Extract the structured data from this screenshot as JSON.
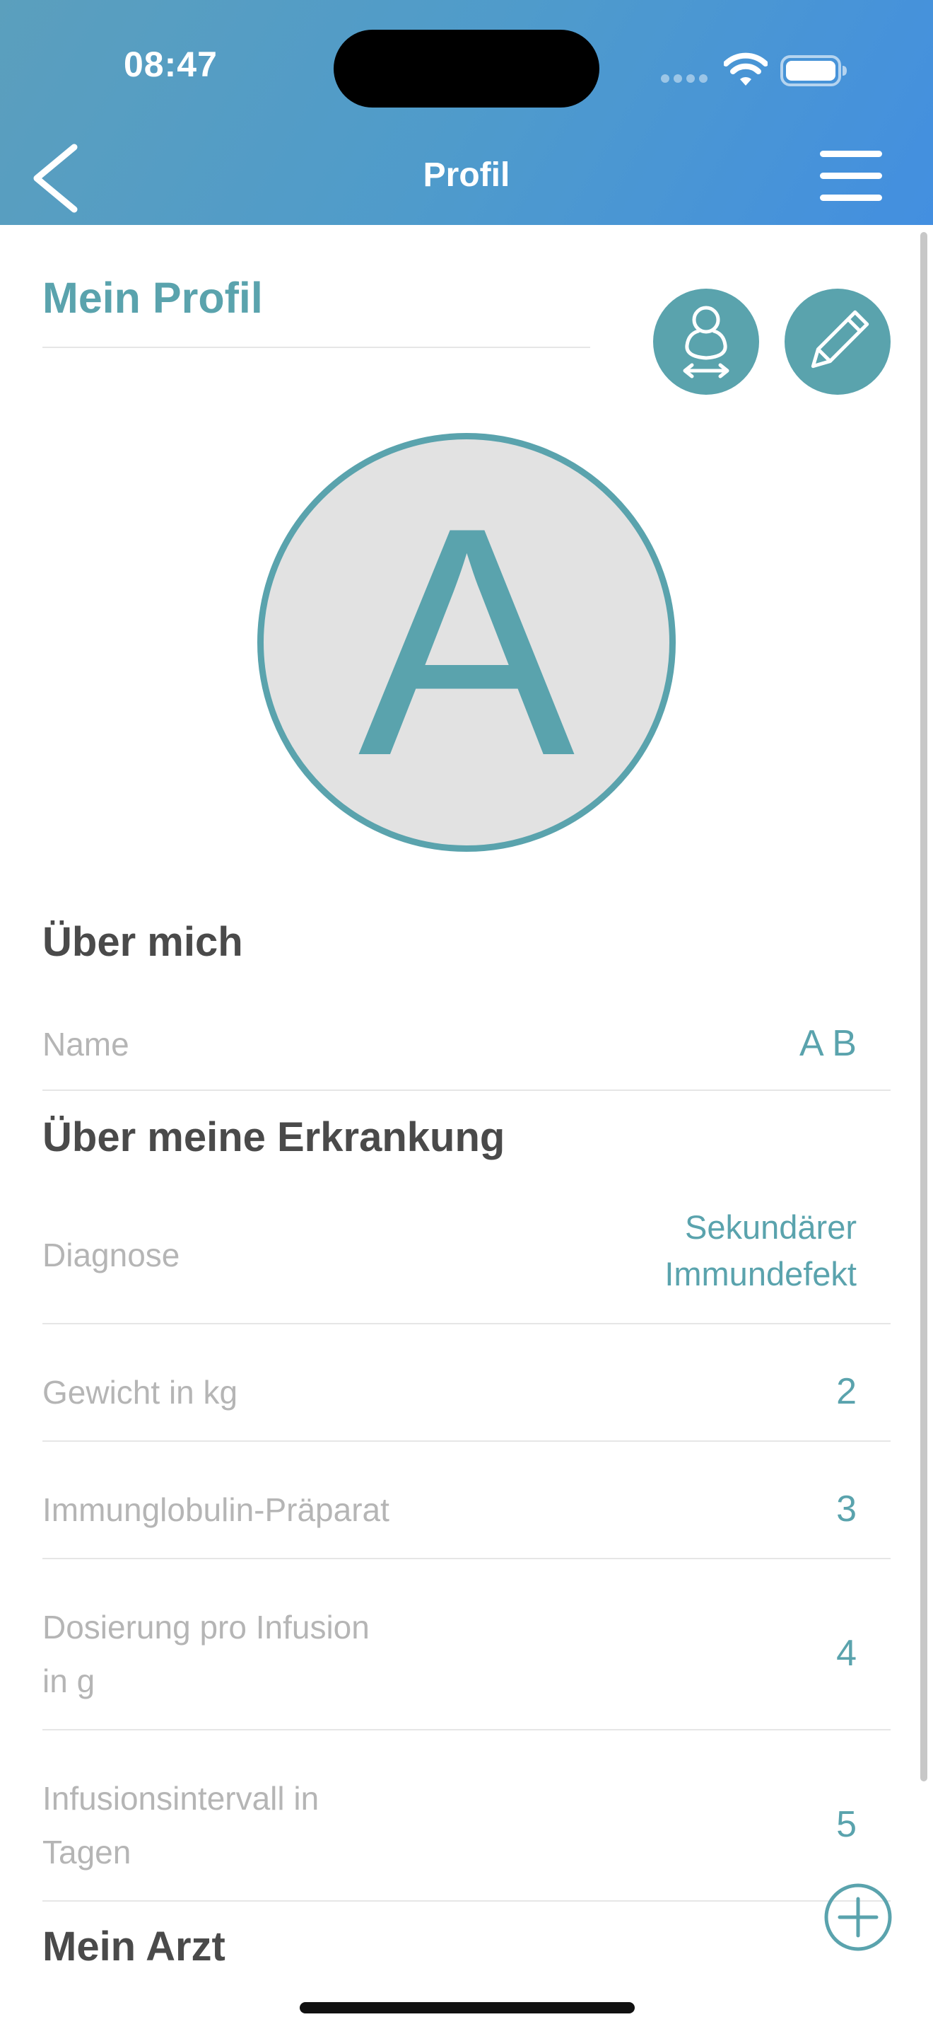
{
  "status_bar": {
    "time": "08:47"
  },
  "nav": {
    "title": "Profil",
    "back_icon": "chevron-left-icon",
    "menu_icon": "hamburger-menu-icon"
  },
  "profile": {
    "title": "Mein Profil",
    "avatar_initial": "A",
    "body_measure_icon": "person-width-icon",
    "edit_icon": "pencil-icon"
  },
  "about_me": {
    "heading": "Über mich",
    "rows": [
      {
        "label": "Name",
        "value": "A B"
      }
    ]
  },
  "illness": {
    "heading": "Über meine Erkrankung",
    "rows": [
      {
        "label": "Diagnose",
        "value_line1": "Sekundärer",
        "value_line2": "Immundefekt"
      },
      {
        "label": "Gewicht in kg",
        "value": "2"
      },
      {
        "label": "Immunglobulin-Präparat",
        "value": "3"
      },
      {
        "label_line1": "Dosierung pro Infusion",
        "label_line2": "in g",
        "value": "4"
      },
      {
        "label_line1": "Infusionsintervall in",
        "label_line2": "Tagen",
        "value": "5"
      }
    ]
  },
  "doctor": {
    "heading": "Mein Arzt",
    "add_icon": "plus-circle-icon"
  },
  "colors": {
    "accent": "#5aa3ad",
    "header_start": "#5b9fbd",
    "header_end": "#438fe0",
    "label_gray": "#b5b5b5",
    "heading_gray": "#4a4a4a"
  }
}
